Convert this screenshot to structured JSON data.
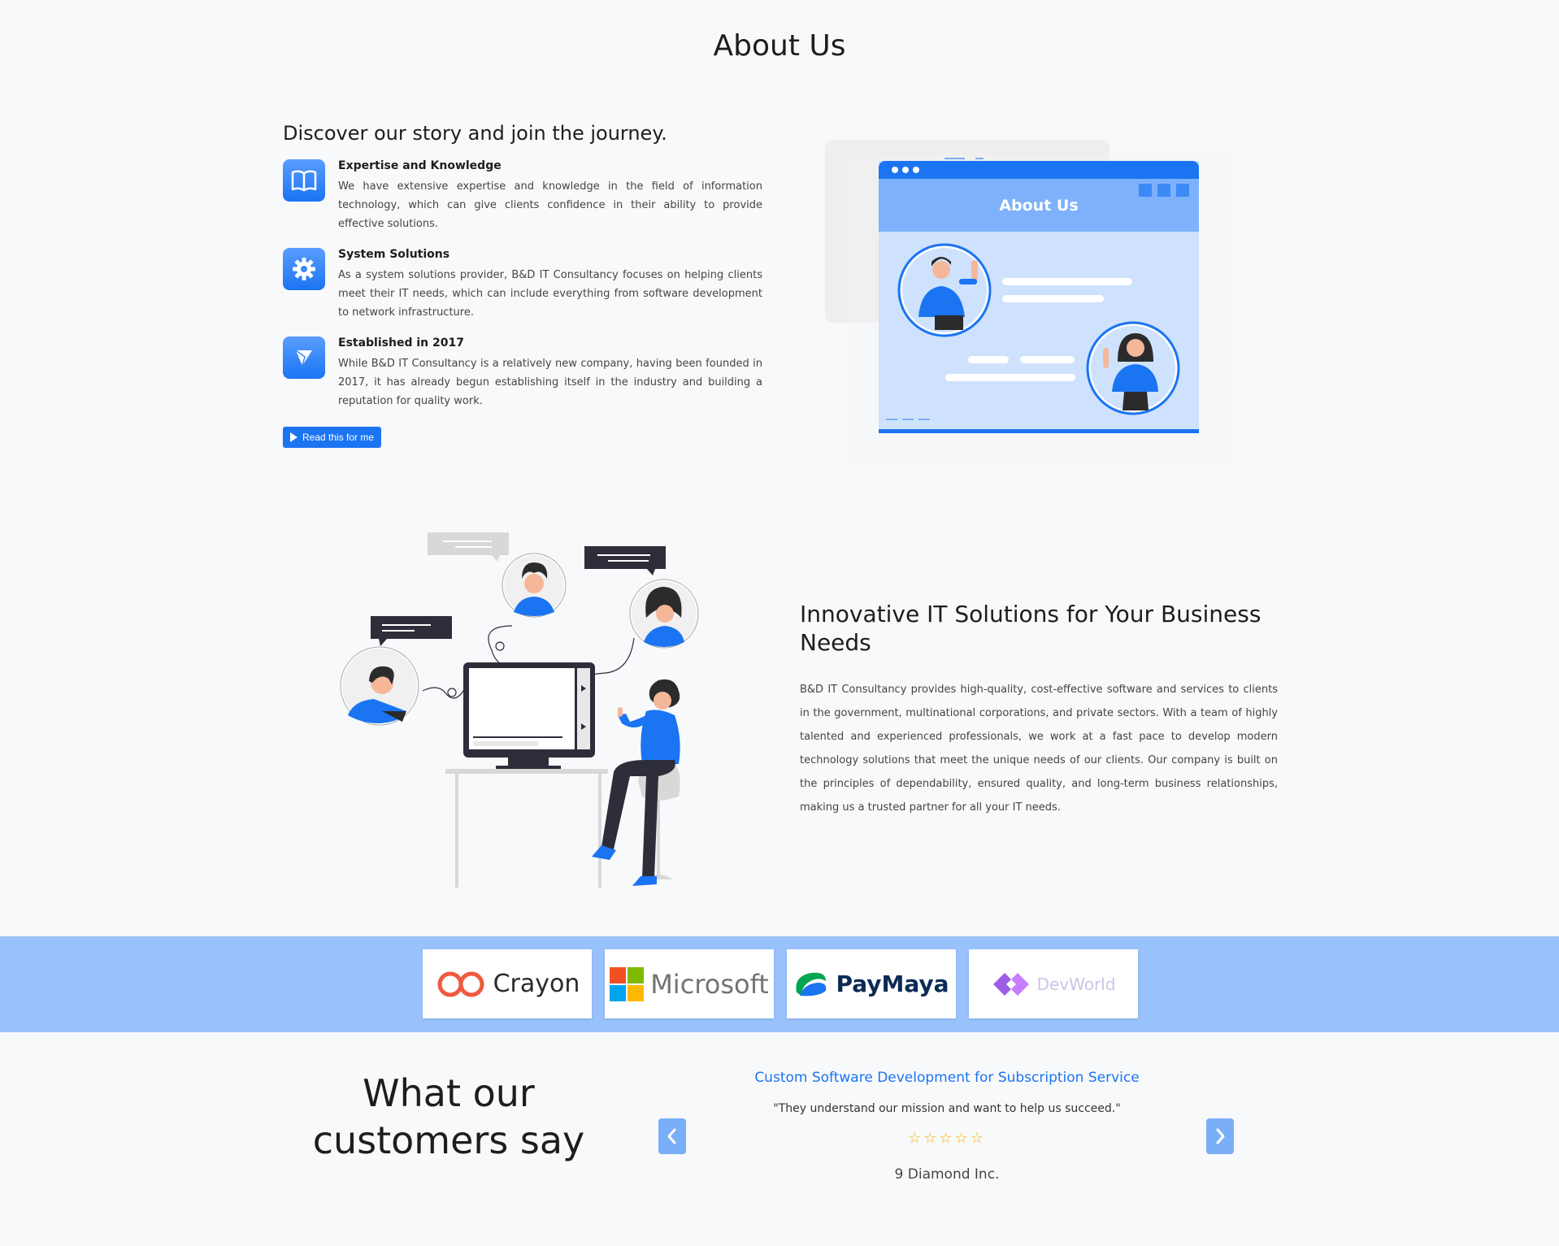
{
  "page": {
    "title": "About Us"
  },
  "story": {
    "heading": "Discover our story and join the journey.",
    "features": [
      {
        "icon": "open-book-icon",
        "title": "Expertise and Knowledge",
        "text": "We have extensive expertise and knowledge in the field of information technology, which can give clients confidence in their ability to provide effective solutions."
      },
      {
        "icon": "gear-icon",
        "title": "System Solutions",
        "text": "As a system solutions provider, B&D IT Consultancy focuses on helping clients meet their IT needs, which can include everything from software development to network infrastructure."
      },
      {
        "icon": "paper-plane-icon",
        "title": "Established in 2017",
        "text": "While B&D IT Consultancy is a relatively new company, having been founded in 2017, it has already begun establishing itself in the industry and building a reputation for quality work."
      }
    ],
    "read_button": "Read this for me"
  },
  "illustration": {
    "window_title": "About Us"
  },
  "solutions": {
    "heading": "Innovative IT Solutions for Your Business Needs",
    "text": "B&D IT Consultancy provides high-quality, cost-effective software and services to clients in the government, multinational corporations, and private sectors. With a team of highly talented and experienced professionals, we work at a fast pace to develop modern technology solutions that meet the unique needs of our clients. Our company is built on the principles of dependability, ensured quality, and long-term business relationships, making us a trusted partner for all your IT needs."
  },
  "partners": [
    "Crayon",
    "Microsoft",
    "PayMaya",
    "DevWorld"
  ],
  "testimonials": {
    "heading": "What our customers say",
    "title": "Custom Software Development for Subscription Service",
    "quote": "\"They understand our mission and want to help us succeed.\"",
    "stars": "☆☆☆☆☆",
    "rating": 5,
    "author": "9 Diamond Inc."
  },
  "colors": {
    "accent": "#1b74f2",
    "band": "#99c1fb",
    "star": "#f4b400"
  }
}
